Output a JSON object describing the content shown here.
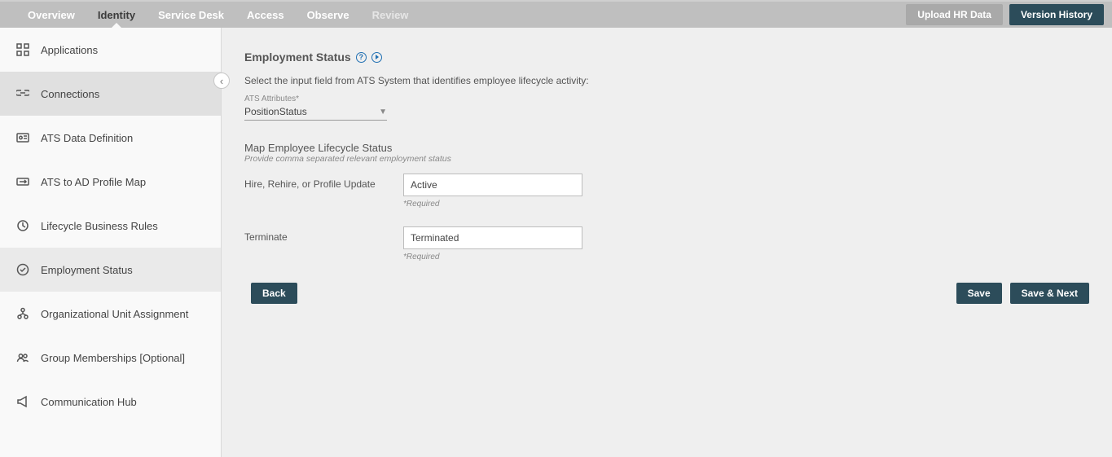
{
  "nav": {
    "items": [
      {
        "label": "Overview"
      },
      {
        "label": "Identity"
      },
      {
        "label": "Service Desk"
      },
      {
        "label": "Access"
      },
      {
        "label": "Observe"
      },
      {
        "label": "Review"
      }
    ],
    "upload_btn": "Upload HR Data",
    "version_btn": "Version History"
  },
  "sidebar": {
    "items": [
      {
        "label": "Applications"
      },
      {
        "label": "Connections"
      },
      {
        "label": "ATS Data Definition"
      },
      {
        "label": "ATS to AD Profile Map"
      },
      {
        "label": "Lifecycle Business Rules"
      },
      {
        "label": "Employment Status"
      },
      {
        "label": "Organizational Unit Assignment"
      },
      {
        "label": "Group Memberships [Optional]"
      },
      {
        "label": "Communication Hub"
      }
    ]
  },
  "main": {
    "title": "Employment Status",
    "intro": "Select the input field from ATS System that identifies employee lifecycle activity:",
    "ats_label": "ATS Attributes*",
    "ats_value": "PositionStatus",
    "map_title": "Map Employee Lifecycle Status",
    "map_hint": "Provide comma separated relevant employment status",
    "hire_label": "Hire, Rehire, or Profile Update",
    "hire_value": "Active",
    "terminate_label": "Terminate",
    "terminate_value": "Terminated",
    "required": "*Required",
    "back": "Back",
    "save": "Save",
    "save_next": "Save & Next"
  }
}
